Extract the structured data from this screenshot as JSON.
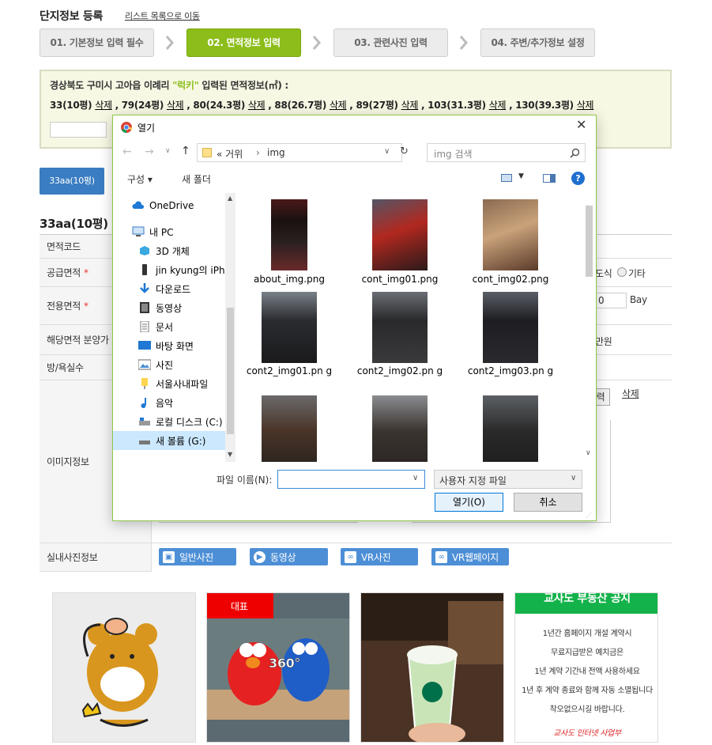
{
  "page": {
    "title": "단지정보 등록",
    "back_link": "리스트 목록으로 이동",
    "steps": [
      "01. 기본정보 입력 필수",
      "02. 면적정보 입력",
      "03. 관련사진 입력",
      "04. 주변/추가정보 설정"
    ],
    "info": {
      "line1_prefix": "경상북도 구미시 고아읍 이례리 ",
      "line1_name": "\"럭키\"",
      "line1_suffix": " 입력된 면적정보(㎡) :",
      "areas": [
        {
          "label": "33(10평)",
          "delete": "삭제"
        },
        {
          "label": "79(24평)",
          "delete": "삭제"
        },
        {
          "label": "80(24.3평)",
          "delete": "삭제"
        },
        {
          "label": "88(26.7평)",
          "delete": "삭제"
        },
        {
          "label": "89(27평)",
          "delete": "삭제"
        },
        {
          "label": "103(31.3평)",
          "delete": "삭제"
        },
        {
          "label": "130(39.3평)",
          "delete": "삭제"
        }
      ]
    },
    "area_tab": "33aa(10평)",
    "section_title": "33aa(10평)",
    "rows": {
      "code": "면적코드",
      "supply": "공급면적",
      "exclusive": "전용면적",
      "price": "해당면적 분양가",
      "rooms": "방/욕실수",
      "images": "이미지정보",
      "interior": "실내사진정보"
    },
    "partial": {
      "type_label": "도식",
      "etc_label": "기타",
      "bay_value": "0",
      "bay_label": "Bay",
      "price_unit": "만원",
      "input_btn": "력",
      "delete": "삭제"
    },
    "media_buttons": [
      "일반사진",
      "동영상",
      "VR사진",
      "VR웹페이지"
    ],
    "photos": {
      "badge": "대표",
      "notice_title": "교사도 부동산 공지",
      "notice_lines": [
        "1년간 홈페이지 개설 계약시",
        "무료지급받은 예치금은",
        "1년 계약 기간내 전액 사용하세요",
        "1년 후 계약 종료와 함께 자동 소멸됩니다",
        "착오없으시길 바랍니다."
      ],
      "notice_sign": "교사도 인터넷 사업부"
    }
  },
  "dialog": {
    "title": "열기",
    "path": [
      "« 거위",
      "img"
    ],
    "search_placeholder": "img 검색",
    "organize": "구성 ▾",
    "new_folder": "새 폴더",
    "nav": [
      "OneDrive",
      "내 PC",
      "3D 개체",
      "jin kyung의 iPhone",
      "다운로드",
      "동영상",
      "문서",
      "바탕 화면",
      "사진",
      "서울사내파일",
      "음악",
      "로컬 디스크 (C:)",
      "새 볼륨 (G:)"
    ],
    "files": [
      {
        "name": "about_img.png"
      },
      {
        "name": "cont_img01.png"
      },
      {
        "name": "cont_img02.png"
      },
      {
        "name": "cont2_img01.pn g"
      },
      {
        "name": "cont2_img02.pn g"
      },
      {
        "name": "cont2_img03.pn g"
      },
      {
        "name": ""
      },
      {
        "name": ""
      },
      {
        "name": ""
      }
    ],
    "filename_label": "파일 이름(N):",
    "filetype": "사용자 지정 파일",
    "open_btn": "열기(O)",
    "cancel_btn": "취소"
  },
  "colors": {
    "step_active": "#8cbd1a",
    "tab_blue": "#3a7dc2",
    "media_blue": "#4d8fd6",
    "info_bg": "#f7f8e4"
  }
}
